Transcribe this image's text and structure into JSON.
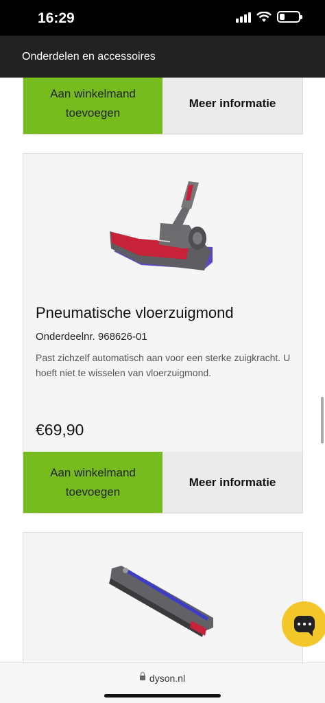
{
  "status_bar": {
    "time": "16:29"
  },
  "header": {
    "title": "Onderdelen en accessoires"
  },
  "cards": [
    {
      "add_label": "Aan winkelmand toevoegen",
      "info_label": "Meer informatie"
    },
    {
      "image": "floor-nozzle-image",
      "name": "Pneumatische vloerzuigmond",
      "part_number": "Onderdeelnr. 968626-01",
      "description": "Past zichzelf automatisch aan voor een sterke zuigkracht. U hoeft niet te wisselen van vloerzuigmond.",
      "price": "€69,90",
      "add_label": "Aan winkelmand toevoegen",
      "info_label": "Meer informatie"
    },
    {
      "image": "crevice-tool-image"
    }
  ],
  "chat": {
    "icon": "chat-icon",
    "color": "#f3c62a"
  },
  "browser": {
    "url": "dyson.nl"
  },
  "colors": {
    "accent_green": "#77bc1f",
    "header_bg": "#222222"
  }
}
